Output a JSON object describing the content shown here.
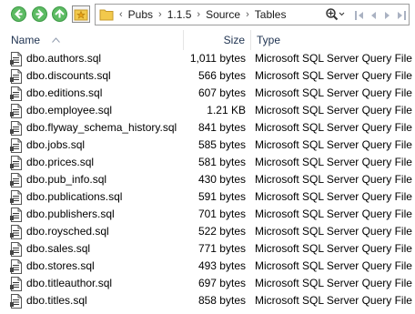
{
  "address": {
    "crumbs": [
      "Pubs",
      "1.1.5",
      "Source",
      "Tables"
    ]
  },
  "icons": {
    "back": "back-arrow-icon",
    "forward": "forward-arrow-icon",
    "up": "up-arrow-icon",
    "favorites": "favorites-star-icon",
    "folder": "folder-icon",
    "search": "search-icon",
    "file": "sql-file-icon"
  },
  "colors": {
    "nav_green": "#5dbb63",
    "header_text": "#1e3250",
    "folder_yellow": "#f2c94c"
  },
  "columns": {
    "name": "Name",
    "size": "Size",
    "type": "Type"
  },
  "files": [
    {
      "name": "dbo.authors.sql",
      "size": "1,011 bytes",
      "type": "Microsoft SQL Server Query File"
    },
    {
      "name": "dbo.discounts.sql",
      "size": "566 bytes",
      "type": "Microsoft SQL Server Query File"
    },
    {
      "name": "dbo.editions.sql",
      "size": "607 bytes",
      "type": "Microsoft SQL Server Query File"
    },
    {
      "name": "dbo.employee.sql",
      "size": "1.21 KB",
      "type": "Microsoft SQL Server Query File"
    },
    {
      "name": "dbo.flyway_schema_history.sql",
      "size": "841 bytes",
      "type": "Microsoft SQL Server Query File"
    },
    {
      "name": "dbo.jobs.sql",
      "size": "585 bytes",
      "type": "Microsoft SQL Server Query File"
    },
    {
      "name": "dbo.prices.sql",
      "size": "581 bytes",
      "type": "Microsoft SQL Server Query File"
    },
    {
      "name": "dbo.pub_info.sql",
      "size": "430 bytes",
      "type": "Microsoft SQL Server Query File"
    },
    {
      "name": "dbo.publications.sql",
      "size": "591 bytes",
      "type": "Microsoft SQL Server Query File"
    },
    {
      "name": "dbo.publishers.sql",
      "size": "701 bytes",
      "type": "Microsoft SQL Server Query File"
    },
    {
      "name": "dbo.roysched.sql",
      "size": "522 bytes",
      "type": "Microsoft SQL Server Query File"
    },
    {
      "name": "dbo.sales.sql",
      "size": "771 bytes",
      "type": "Microsoft SQL Server Query File"
    },
    {
      "name": "dbo.stores.sql",
      "size": "493 bytes",
      "type": "Microsoft SQL Server Query File"
    },
    {
      "name": "dbo.titleauthor.sql",
      "size": "697 bytes",
      "type": "Microsoft SQL Server Query File"
    },
    {
      "name": "dbo.titles.sql",
      "size": "858 bytes",
      "type": "Microsoft SQL Server Query File"
    }
  ]
}
